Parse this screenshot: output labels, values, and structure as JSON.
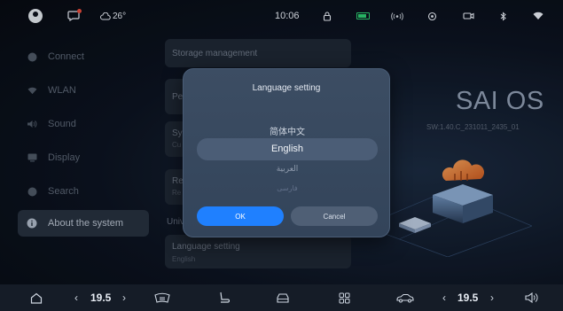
{
  "status_bar": {
    "weather": "26°",
    "time": "10:06",
    "icons": [
      "avatar",
      "message-icon",
      "weather-cloud-icon",
      "lock-icon",
      "battery-icon",
      "signal-icon",
      "navigation-icon",
      "camera-icon",
      "bluetooth-icon",
      "wifi-icon"
    ]
  },
  "sidebar": {
    "items": [
      {
        "label": "Connect",
        "icon": "connect-icon"
      },
      {
        "label": "WLAN",
        "icon": "wifi-icon"
      },
      {
        "label": "Sound",
        "icon": "speaker-icon"
      },
      {
        "label": "Display",
        "icon": "display-icon"
      },
      {
        "label": "Search",
        "icon": "search-icon"
      },
      {
        "label": "About the system",
        "icon": "info-icon",
        "active": true
      }
    ]
  },
  "list": {
    "storage": "Storage management",
    "pe_partial": "Pe",
    "sy_partial": "Sy",
    "sy_sub": "Cu",
    "re_partial": "Re",
    "re_sub": "Re",
    "section_partial": "Univ",
    "language_title": "Language setting",
    "language_value": "English"
  },
  "brand": {
    "name": "SAI OS",
    "version": "SW:1.40.C_231011_2435_01"
  },
  "dialog": {
    "title": "Language setting",
    "options": [
      "简体中文",
      "English",
      "العربية",
      "فارسی"
    ],
    "selected_index": 1,
    "ok_label": "OK",
    "cancel_label": "Cancel"
  },
  "dock": {
    "left_temp": "19.5",
    "right_temp": "19.5",
    "icons": [
      "home-icon",
      "temp-decrease-left-icon",
      "temp-increase-left-icon",
      "heated-windshield-icon",
      "seat-icon",
      "car-icon",
      "apps-grid-icon",
      "vehicle-icon",
      "temp-decrease-right-icon",
      "temp-increase-right-icon",
      "volume-icon"
    ]
  },
  "colors": {
    "accent": "#1f80ff",
    "dialog_bg": "#374860",
    "selected_option": "#4b5d76"
  }
}
